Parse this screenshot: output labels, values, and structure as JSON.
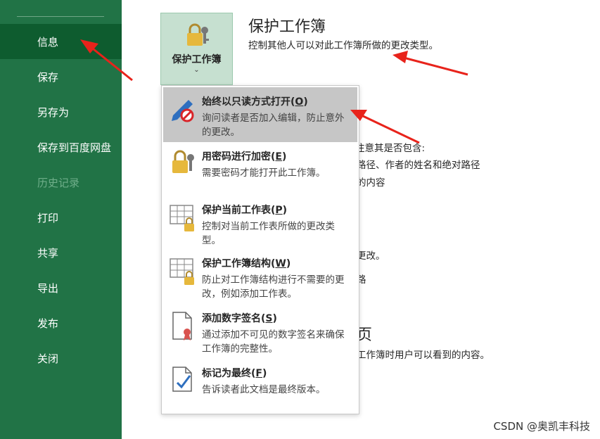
{
  "sidebar": {
    "items": [
      {
        "label": "信息",
        "active": true
      },
      {
        "label": "保存"
      },
      {
        "label": "另存为"
      },
      {
        "label": "保存到百度网盘"
      },
      {
        "label": "历史记录",
        "disabled": true
      },
      {
        "label": "打印"
      },
      {
        "label": "共享"
      },
      {
        "label": "导出"
      },
      {
        "label": "发布"
      },
      {
        "label": "关闭"
      }
    ]
  },
  "protect": {
    "button_label": "保护工作簿",
    "chevron": "⌄",
    "title": "保护工作簿",
    "description": "控制其他人可以对此工作簿所做的更改类型。"
  },
  "background_text": {
    "line1": "注意其是否包含:",
    "line2": "路径、作者的姓名和绝对路径",
    "line3": "的内容",
    "line4": "更改。",
    "line5": "路",
    "heading_fragment": "页",
    "line6": "工作簿时用户可以看到的内容。"
  },
  "menu": {
    "items": [
      {
        "title": "始终以只读方式打开",
        "key": "O",
        "desc": "询问读者是否加入编辑，防止意外的更改。"
      },
      {
        "title": "用密码进行加密",
        "key": "E",
        "desc": "需要密码才能打开此工作簿。"
      },
      {
        "title": "保护当前工作表",
        "key": "P",
        "desc": "控制对当前工作表所做的更改类型。"
      },
      {
        "title": "保护工作簿结构",
        "key": "W",
        "desc": "防止对工作簿结构进行不需要的更改，例如添加工作表。"
      },
      {
        "title": "添加数字签名",
        "key": "S",
        "desc": "通过添加不可见的数字签名来确保工作簿的完整性。"
      },
      {
        "title": "标记为最终",
        "key": "F",
        "desc": "告诉读者此文档是最终版本。"
      }
    ]
  },
  "watermark": "CSDN @奥凯丰科技",
  "colors": {
    "sidebar": "#217346",
    "sidebar_active": "#0e5c2f",
    "annotation_arrow": "#e8231b",
    "highlight": "#c6c6c6"
  }
}
